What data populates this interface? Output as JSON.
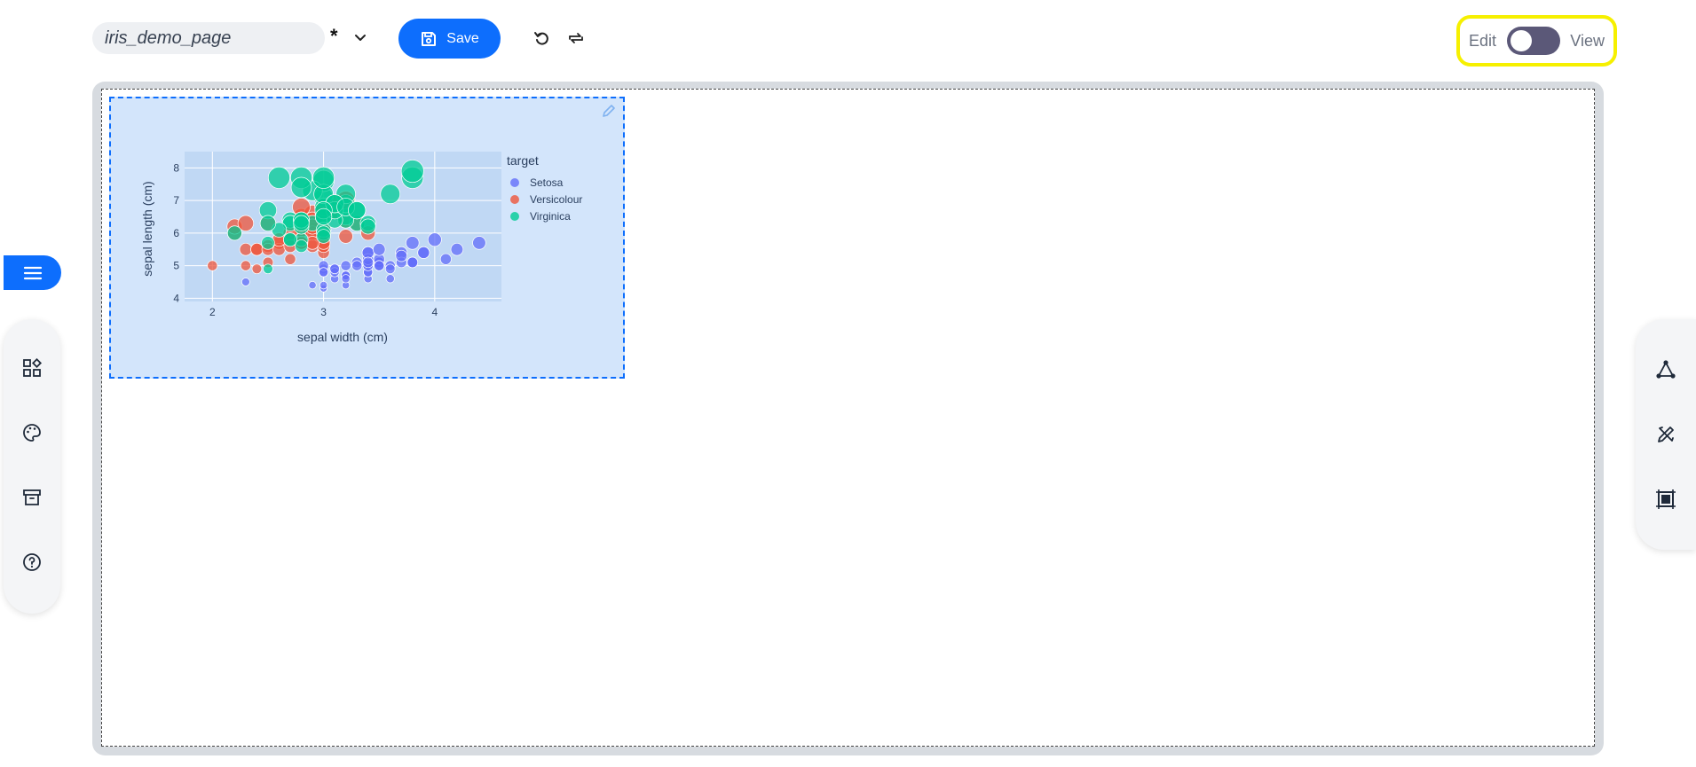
{
  "header": {
    "page_name": "iris_demo_page",
    "dirty_marker": "*",
    "save_label": "Save",
    "mode_edit_label": "Edit",
    "mode_view_label": "View",
    "mode_toggle_on": false
  },
  "colors": {
    "accent": "#0d6efd",
    "toggle_highlight": "#f6f000",
    "toggle_track": "#5b5878",
    "chart_card_bg": "#d3e5fb",
    "plot_bg": "#c0d8f4"
  },
  "icons": {
    "left_rail": [
      "components-icon",
      "palette-icon",
      "archive-icon",
      "help-icon"
    ],
    "right_rail": [
      "graph-icon",
      "design-tools-icon",
      "frame-icon"
    ]
  },
  "chart_data": {
    "type": "scatter",
    "xlabel": "sepal width (cm)",
    "ylabel": "sepal length (cm)",
    "xlim": [
      1.75,
      4.6
    ],
    "ylim": [
      3.9,
      8.5
    ],
    "xticks": [
      2,
      3,
      4
    ],
    "yticks": [
      4,
      5,
      6,
      7,
      8
    ],
    "grid": true,
    "legend_title": "target",
    "legend_position": "right",
    "marker_size_encodes": "sepal length (cm)",
    "series": [
      {
        "name": "Setosa",
        "color": "#636efa",
        "x": [
          3.5,
          3.0,
          3.2,
          3.1,
          3.6,
          3.9,
          3.4,
          3.4,
          2.9,
          3.1,
          3.7,
          3.4,
          3.0,
          3.0,
          4.0,
          4.4,
          3.9,
          3.5,
          3.8,
          3.8,
          3.4,
          3.7,
          3.6,
          3.3,
          3.4,
          3.0,
          3.4,
          3.5,
          3.4,
          3.2,
          3.1,
          3.4,
          4.1,
          4.2,
          3.1,
          3.2,
          3.5,
          3.6,
          3.0,
          3.4,
          3.5,
          2.3,
          3.2,
          3.5,
          3.8,
          3.0,
          3.8,
          3.2,
          3.7,
          3.3
        ],
        "y": [
          5.1,
          4.9,
          4.7,
          4.6,
          5.0,
          5.4,
          4.6,
          5.0,
          4.4,
          4.9,
          5.4,
          4.8,
          4.8,
          4.3,
          5.8,
          5.7,
          5.4,
          5.1,
          5.7,
          5.1,
          5.4,
          5.1,
          4.6,
          5.1,
          4.8,
          5.0,
          5.0,
          5.2,
          5.2,
          4.7,
          4.8,
          5.4,
          5.2,
          5.5,
          4.9,
          5.0,
          5.5,
          4.9,
          4.4,
          5.1,
          5.0,
          4.5,
          4.4,
          5.0,
          5.1,
          4.8,
          5.1,
          4.6,
          5.3,
          5.0
        ]
      },
      {
        "name": "Versicolour",
        "color": "#ef553b",
        "x": [
          3.2,
          3.2,
          3.1,
          2.3,
          2.8,
          2.8,
          3.3,
          2.4,
          2.9,
          2.7,
          2.0,
          3.0,
          2.2,
          2.9,
          2.9,
          3.1,
          3.0,
          2.7,
          2.2,
          2.5,
          3.2,
          2.8,
          2.5,
          2.8,
          2.9,
          3.0,
          2.8,
          3.0,
          2.9,
          2.6,
          2.4,
          2.4,
          2.7,
          2.7,
          3.0,
          3.4,
          3.1,
          2.3,
          3.0,
          2.5,
          2.6,
          3.0,
          2.6,
          2.3,
          2.7,
          3.0,
          2.9,
          2.9,
          2.5,
          2.8
        ],
        "y": [
          7.0,
          6.4,
          6.9,
          5.5,
          6.5,
          5.7,
          6.3,
          4.9,
          6.6,
          5.2,
          5.0,
          5.9,
          6.0,
          6.1,
          5.6,
          6.7,
          5.6,
          5.8,
          6.2,
          5.6,
          5.9,
          6.1,
          6.3,
          6.1,
          6.4,
          6.6,
          6.8,
          6.7,
          6.0,
          5.7,
          5.5,
          5.5,
          5.8,
          6.0,
          5.4,
          6.0,
          6.7,
          6.3,
          5.6,
          5.5,
          5.5,
          6.1,
          5.8,
          5.0,
          5.6,
          5.7,
          5.7,
          6.2,
          5.1,
          5.7
        ]
      },
      {
        "name": "Virginica",
        "color": "#00cc96",
        "x": [
          3.3,
          2.7,
          3.0,
          2.9,
          3.0,
          3.0,
          2.5,
          2.9,
          2.5,
          3.6,
          3.2,
          2.7,
          3.0,
          2.5,
          2.8,
          3.2,
          3.0,
          3.8,
          2.6,
          2.2,
          3.2,
          2.8,
          2.8,
          2.7,
          3.3,
          3.2,
          2.8,
          3.0,
          2.8,
          3.0,
          2.8,
          3.8,
          2.8,
          2.8,
          2.6,
          3.0,
          3.4,
          3.1,
          3.0,
          3.1,
          3.1,
          3.1,
          2.7,
          3.2,
          3.3,
          3.0,
          2.5,
          3.0,
          3.4,
          3.0
        ],
        "y": [
          6.3,
          5.8,
          7.1,
          6.3,
          6.5,
          7.6,
          4.9,
          7.3,
          6.7,
          7.2,
          6.5,
          6.4,
          6.8,
          5.7,
          5.8,
          6.4,
          6.5,
          7.7,
          7.7,
          6.0,
          6.9,
          5.6,
          7.7,
          6.3,
          6.7,
          7.2,
          6.2,
          6.1,
          6.4,
          7.2,
          7.4,
          7.9,
          6.4,
          6.3,
          6.1,
          7.7,
          6.3,
          6.4,
          6.0,
          6.9,
          6.7,
          6.9,
          5.8,
          6.8,
          6.7,
          6.7,
          6.3,
          6.5,
          6.2,
          5.9
        ]
      }
    ]
  }
}
